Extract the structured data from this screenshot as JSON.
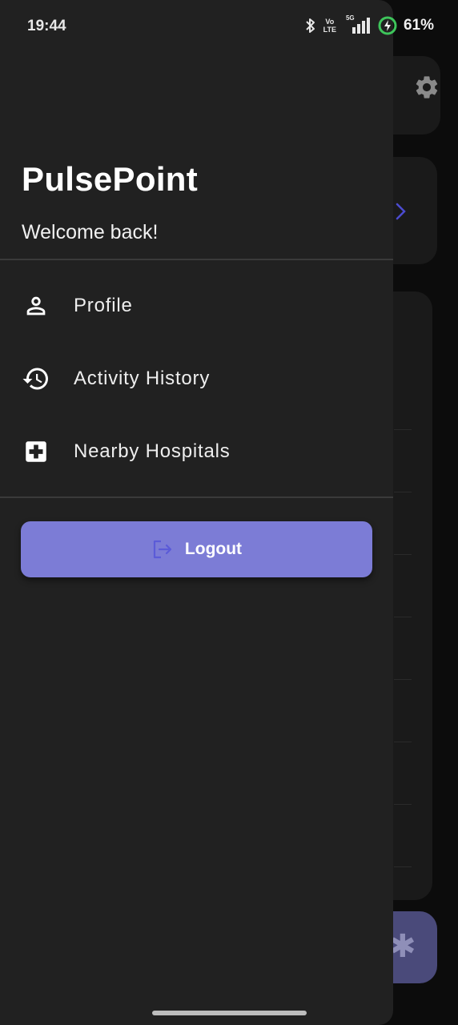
{
  "status_bar": {
    "time": "19:44",
    "network_label": "5G",
    "volte_label": "Vo\nLTE",
    "battery_percent": "61%"
  },
  "drawer": {
    "app_title": "PulsePoint",
    "welcome_text": "Welcome back!",
    "menu": [
      {
        "label": "Profile",
        "icon": "person-icon"
      },
      {
        "label": "Activity History",
        "icon": "history-icon"
      },
      {
        "label": "Nearby Hospitals",
        "icon": "hospital-icon"
      }
    ],
    "logout_label": "Logout"
  },
  "colors": {
    "drawer_bg": "#212121",
    "accent": "#7c7cd6",
    "logout_icon": "#5b5bd8",
    "battery_ring": "#3ec55b"
  }
}
